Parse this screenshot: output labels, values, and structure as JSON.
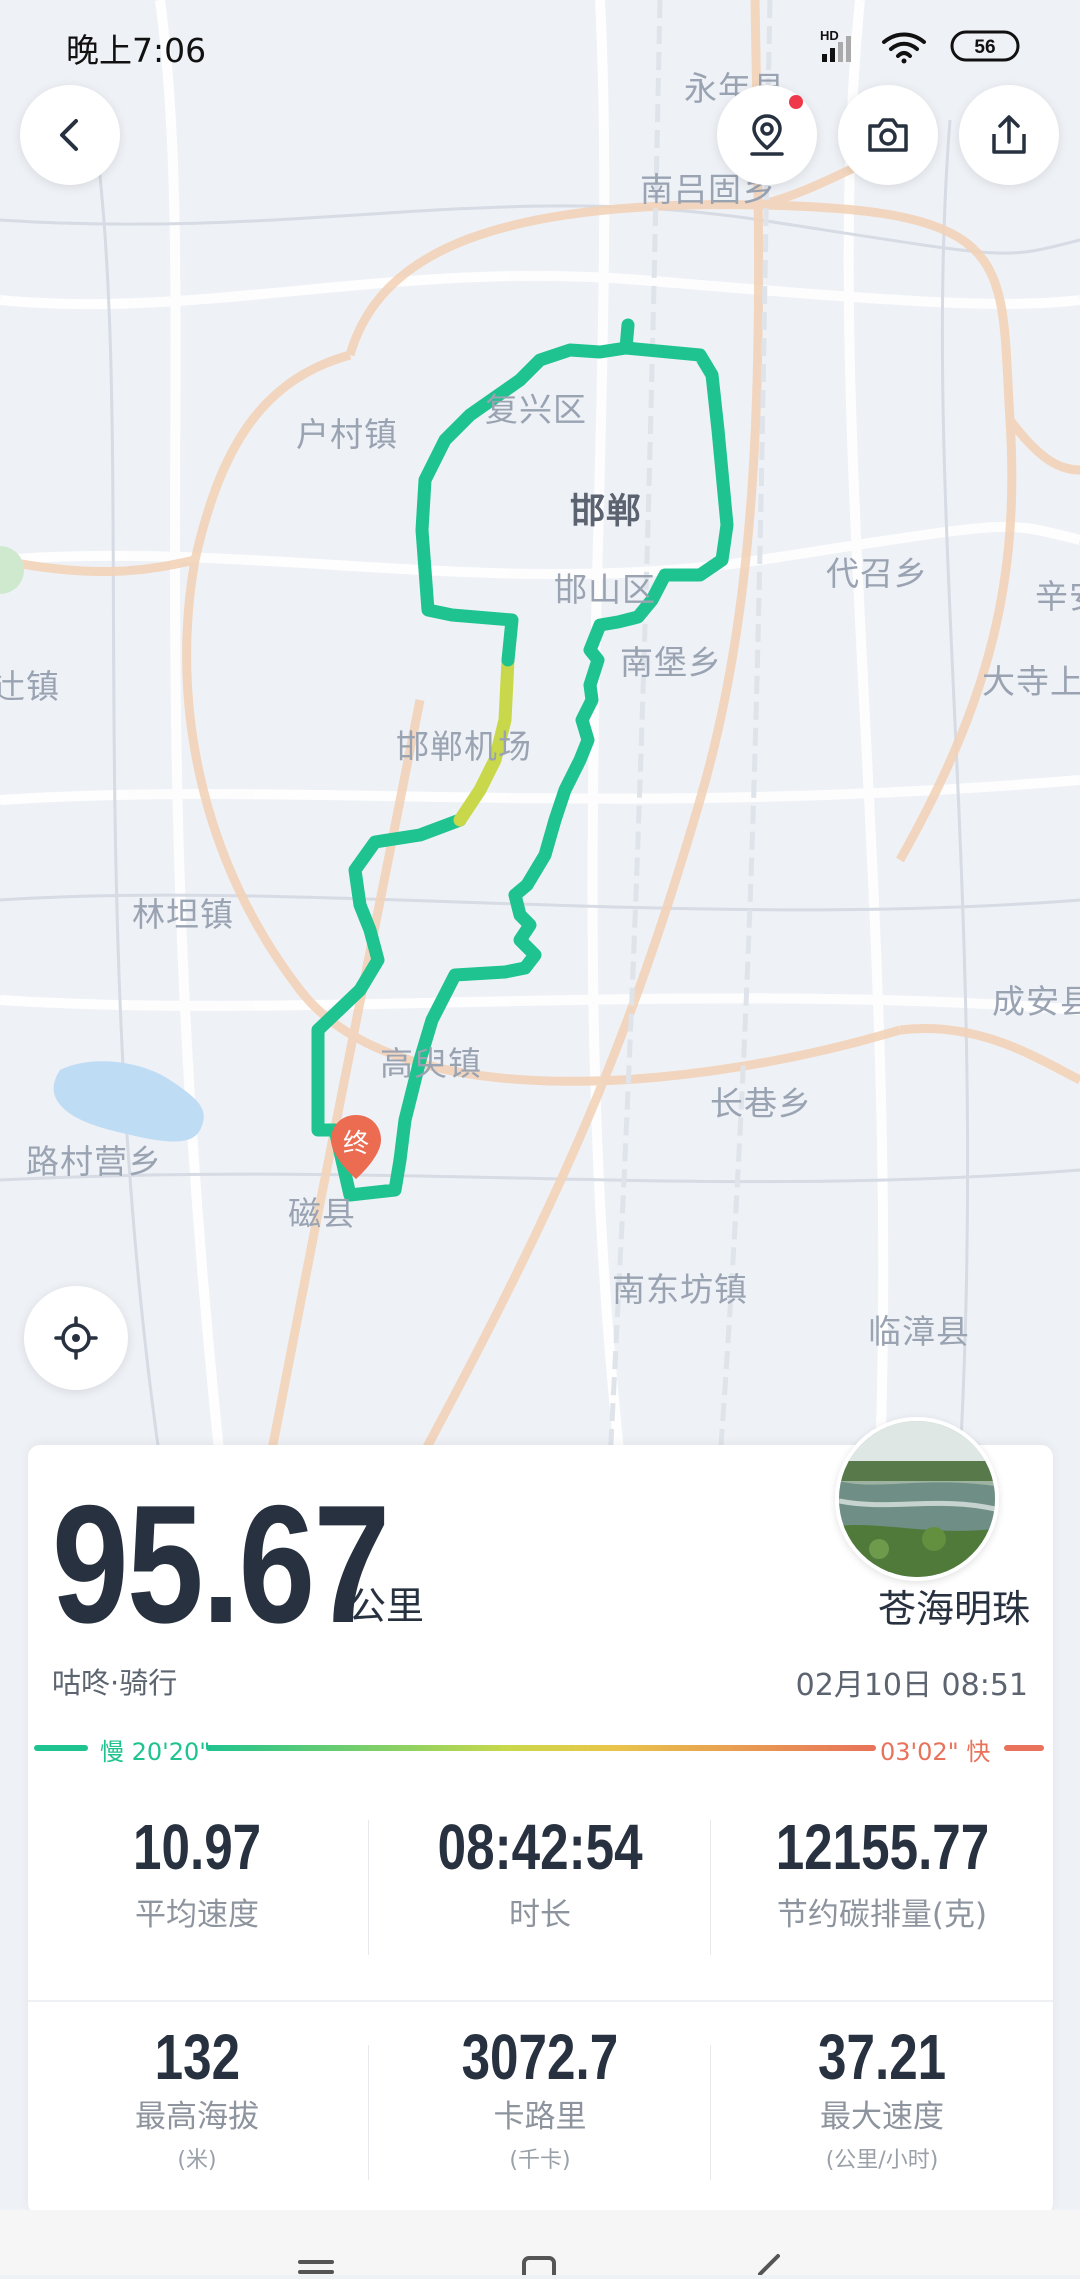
{
  "status_bar": {
    "time": "晚上7:06",
    "battery": "56",
    "network": "HD"
  },
  "map": {
    "labels": {
      "yongnian": "永年县",
      "nanlvgu": "南吕固乡",
      "fuxing": "复兴区",
      "hucun": "户村镇",
      "handan": "邯郸",
      "hanshan": "邯山区",
      "daisan": "代召乡",
      "nanbao": "南堡乡",
      "xin": "辛安",
      "dasi": "大寺上",
      "zhen_left": "辻镇",
      "airport": "邯郸机场",
      "lintan": "林坦镇",
      "chengan": "成安县",
      "gaoyi": "高臾镇",
      "changxiang": "长巷乡",
      "lucun": "路村营乡",
      "cixian": "磁县",
      "nandongfang": "南东坊镇",
      "linzhang": "临漳县"
    },
    "end_marker": "终"
  },
  "summary": {
    "distance": "95.67",
    "distance_unit": "公里",
    "place": "苍海明珠",
    "activity": "咕咚·骑行",
    "datetime": "02月10日 08:51"
  },
  "pace": {
    "slow_label": "慢 20'20\"",
    "fast_label": "03'02\" 快",
    "slow_color": "#1ec38f",
    "fast_color": "#e8725a"
  },
  "stats": [
    {
      "value": "10.97",
      "label": "平均速度",
      "sub": ""
    },
    {
      "value": "08:42:54",
      "label": "时长",
      "sub": ""
    },
    {
      "value": "12155.77",
      "label": "节约碳排量(克)",
      "sub": ""
    },
    {
      "value": "132",
      "label": "最高海拔",
      "sub": "(米)"
    },
    {
      "value": "3072.7",
      "label": "卡路里",
      "sub": "(千卡)"
    },
    {
      "value": "37.21",
      "label": "最大速度",
      "sub": "(公里/小时)"
    }
  ],
  "colors": {
    "route": "#1ec38f",
    "route_slow": "#c9d84a",
    "text_dark": "#27313f",
    "marker": "#ec6c52"
  },
  "icons": [
    "back-arrow-icon",
    "location-pin-icon",
    "camera-icon",
    "share-icon",
    "locate-icon"
  ]
}
